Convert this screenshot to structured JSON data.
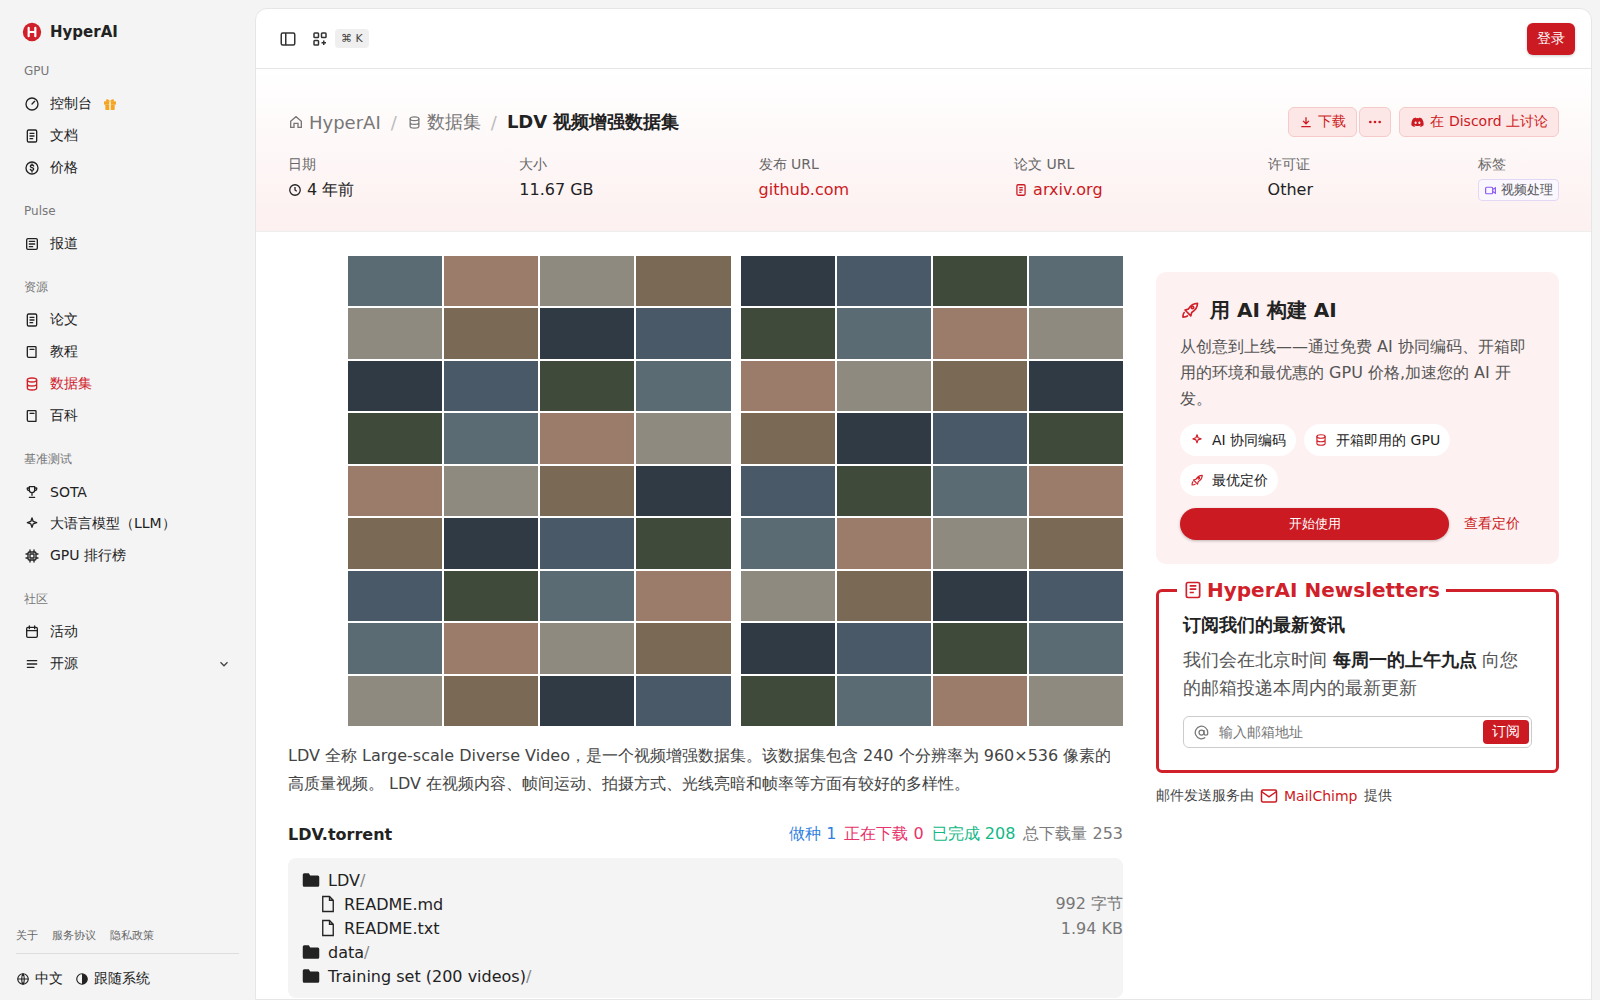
{
  "sidebar": {
    "brand": "HyperAI",
    "sections": [
      {
        "label": "GPU",
        "items": [
          {
            "label": "控制台",
            "selected": false,
            "gift": true,
            "expandable": false,
            "expanded": false
          },
          {
            "label": "文档",
            "selected": false,
            "gift": false,
            "expandable": false,
            "expanded": false
          },
          {
            "label": "价格",
            "selected": false,
            "gift": false,
            "expandable": false,
            "expanded": false
          }
        ]
      },
      {
        "label": "Pulse",
        "items": [
          {
            "label": "报道",
            "selected": false,
            "gift": false,
            "expandable": false,
            "expanded": false
          }
        ]
      },
      {
        "label": "资源",
        "items": [
          {
            "label": "论文",
            "selected": false,
            "gift": false,
            "expandable": false,
            "expanded": false
          },
          {
            "label": "教程",
            "selected": false,
            "gift": false,
            "expandable": false,
            "expanded": false
          },
          {
            "label": "数据集",
            "selected": true,
            "gift": false,
            "expandable": false,
            "expanded": false
          },
          {
            "label": "百科",
            "selected": false,
            "gift": false,
            "expandable": false,
            "expanded": false
          }
        ]
      },
      {
        "label": "基准测试",
        "items": [
          {
            "label": "SOTA",
            "selected": false,
            "gift": false,
            "expandable": false,
            "expanded": false
          },
          {
            "label": "大语言模型（LLM）",
            "selected": false,
            "gift": false,
            "expandable": false,
            "expanded": false
          },
          {
            "label": "GPU 排行榜",
            "selected": false,
            "gift": false,
            "expandable": false,
            "expanded": false
          }
        ]
      },
      {
        "label": "社区",
        "items": [
          {
            "label": "活动",
            "selected": false,
            "gift": false,
            "expandable": false,
            "expanded": false
          },
          {
            "label": "开源",
            "selected": false,
            "gift": false,
            "expandable": true,
            "expanded": false
          }
        ]
      }
    ],
    "footer_links": [
      "关于",
      "服务协议",
      "隐私政策"
    ],
    "language": "中文",
    "theme": "跟随系统"
  },
  "topbar": {
    "shortcut": "⌘ K",
    "login": "登录"
  },
  "header": {
    "breadcrumb": [
      {
        "label": "HyperAI",
        "current": false
      },
      {
        "label": "数据集",
        "current": false
      },
      {
        "label": "LDV 视频增强数据集",
        "current": true
      }
    ],
    "separator": "/",
    "download": "下载",
    "discord": "在 Discord 上讨论",
    "meta": [
      {
        "label": "日期",
        "value": "4 年前",
        "kind": "time"
      },
      {
        "label": "大小",
        "value": "11.67 GB",
        "kind": "plain"
      },
      {
        "label": "发布 URL",
        "value": "github.com",
        "kind": "link"
      },
      {
        "label": "论文 URL",
        "value": "arxiv.org",
        "kind": "paper"
      },
      {
        "label": "许可证",
        "value": "Other",
        "kind": "plain"
      },
      {
        "label": "标签",
        "value": "视频处理",
        "kind": "tag"
      }
    ]
  },
  "content": {
    "description": "LDV 全称 Large-scale Diverse Video，是一个视频增强数据集。该数据集包含 240 个分辨率为 960×536 像素的高质量视频。 LDV 在视频内容、帧间运动、拍摄方式、光线亮暗和帧率等方面有较好的多样性。",
    "torrent": {
      "name": "LDV.torrent",
      "stats": [
        {
          "label": "做种",
          "value": "1",
          "color": "#2f7fe0"
        },
        {
          "label": "正在下载",
          "value": "0",
          "color": "#e8336b"
        },
        {
          "label": "已完成",
          "value": "208",
          "color": "#12b886"
        },
        {
          "label": "总下载量",
          "value": "253",
          "color": "#7a7a7a"
        }
      ],
      "files": [
        {
          "name": "LDV",
          "suffix": "/",
          "size": "",
          "kind": "folder",
          "nested": false
        },
        {
          "name": "README.md",
          "suffix": "",
          "size": "992 字节",
          "kind": "file",
          "nested": true
        },
        {
          "name": "README.txt",
          "suffix": "",
          "size": "1.94 KB",
          "kind": "file",
          "nested": true
        },
        {
          "name": "data",
          "suffix": "/",
          "size": "",
          "kind": "folder",
          "nested": false
        },
        {
          "name": "Training set (200 videos)",
          "suffix": "/",
          "size": "",
          "kind": "folder",
          "nested": false
        }
      ]
    }
  },
  "promo": {
    "title": "用 AI 构建 AI",
    "description": "从创意到上线——通过免费 AI 协同编码、开箱即用的环境和最优惠的 GPU 价格,加速您的 AI 开发。",
    "features": [
      "AI 协同编码",
      "开箱即用的 GPU",
      "最优定价"
    ],
    "primary": "开始使用",
    "secondary": "查看定价"
  },
  "newsletter": {
    "title": "HyperAI Newsletters",
    "heading": "订阅我们的最新资讯",
    "text_before": "我们会在北京时间",
    "text_bold": "每周一的上午九点",
    "text_after": "向您的邮箱投递本周内的最新更新",
    "placeholder": "输入邮箱地址",
    "button": "订阅"
  },
  "provider": {
    "before": "邮件发送服务由",
    "name": "MailChimp",
    "after": "提供"
  }
}
